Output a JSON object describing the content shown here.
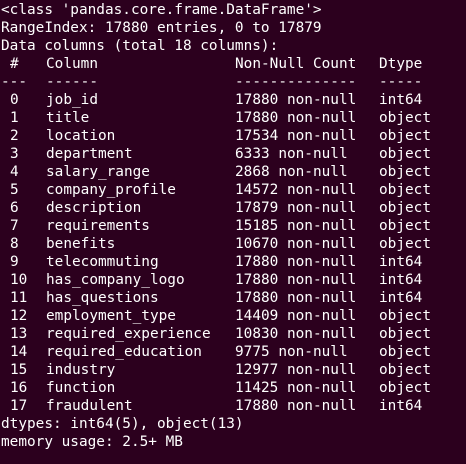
{
  "terminal": {
    "header_lines": [
      "<class 'pandas.core.frame.DataFrame'>",
      "RangeIndex: 17880 entries, 0 to 17879",
      "Data columns (total 18 columns):"
    ],
    "table_header": {
      "num": "#",
      "column": "Column",
      "non_null": "Non-Null Count",
      "dtype": "Dtype"
    },
    "separator": {
      "num": "---",
      "column": "------",
      "non_null": "--------------",
      "dtype": "-----"
    },
    "rows": [
      {
        "num": "0",
        "column": "job_id",
        "non_null": "17880 non-null",
        "dtype": "int64"
      },
      {
        "num": "1",
        "column": "title",
        "non_null": "17880 non-null",
        "dtype": "object"
      },
      {
        "num": "2",
        "column": "location",
        "non_null": "17534 non-null",
        "dtype": "object"
      },
      {
        "num": "3",
        "column": "department",
        "non_null": "6333 non-null",
        "dtype": "object"
      },
      {
        "num": "4",
        "column": "salary_range",
        "non_null": "2868 non-null",
        "dtype": "object"
      },
      {
        "num": "5",
        "column": "company_profile",
        "non_null": "14572 non-null",
        "dtype": "object"
      },
      {
        "num": "6",
        "column": "description",
        "non_null": "17879 non-null",
        "dtype": "object"
      },
      {
        "num": "7",
        "column": "requirements",
        "non_null": "15185 non-null",
        "dtype": "object"
      },
      {
        "num": "8",
        "column": "benefits",
        "non_null": "10670 non-null",
        "dtype": "object"
      },
      {
        "num": "9",
        "column": "telecommuting",
        "non_null": "17880 non-null",
        "dtype": "int64"
      },
      {
        "num": "10",
        "column": "has_company_logo",
        "non_null": "17880 non-null",
        "dtype": "int64"
      },
      {
        "num": "11",
        "column": "has_questions",
        "non_null": "17880 non-null",
        "dtype": "int64"
      },
      {
        "num": "12",
        "column": "employment_type",
        "non_null": "14409 non-null",
        "dtype": "object"
      },
      {
        "num": "13",
        "column": "required_experience",
        "non_null": "10830 non-null",
        "dtype": "object"
      },
      {
        "num": "14",
        "column": "required_education",
        "non_null": "9775 non-null",
        "dtype": "object"
      },
      {
        "num": "15",
        "column": "industry",
        "non_null": "12977 non-null",
        "dtype": "object"
      },
      {
        "num": "16",
        "column": "function",
        "non_null": "11425 non-null",
        "dtype": "object"
      },
      {
        "num": "17",
        "column": "fraudulent",
        "non_null": "17880 non-null",
        "dtype": "int64"
      }
    ],
    "footer_lines": [
      "dtypes: int64(5), object(13)",
      "memory usage: 2.5+ MB"
    ]
  },
  "colors": {
    "background": "#2c001e",
    "text": "#ffffff"
  }
}
